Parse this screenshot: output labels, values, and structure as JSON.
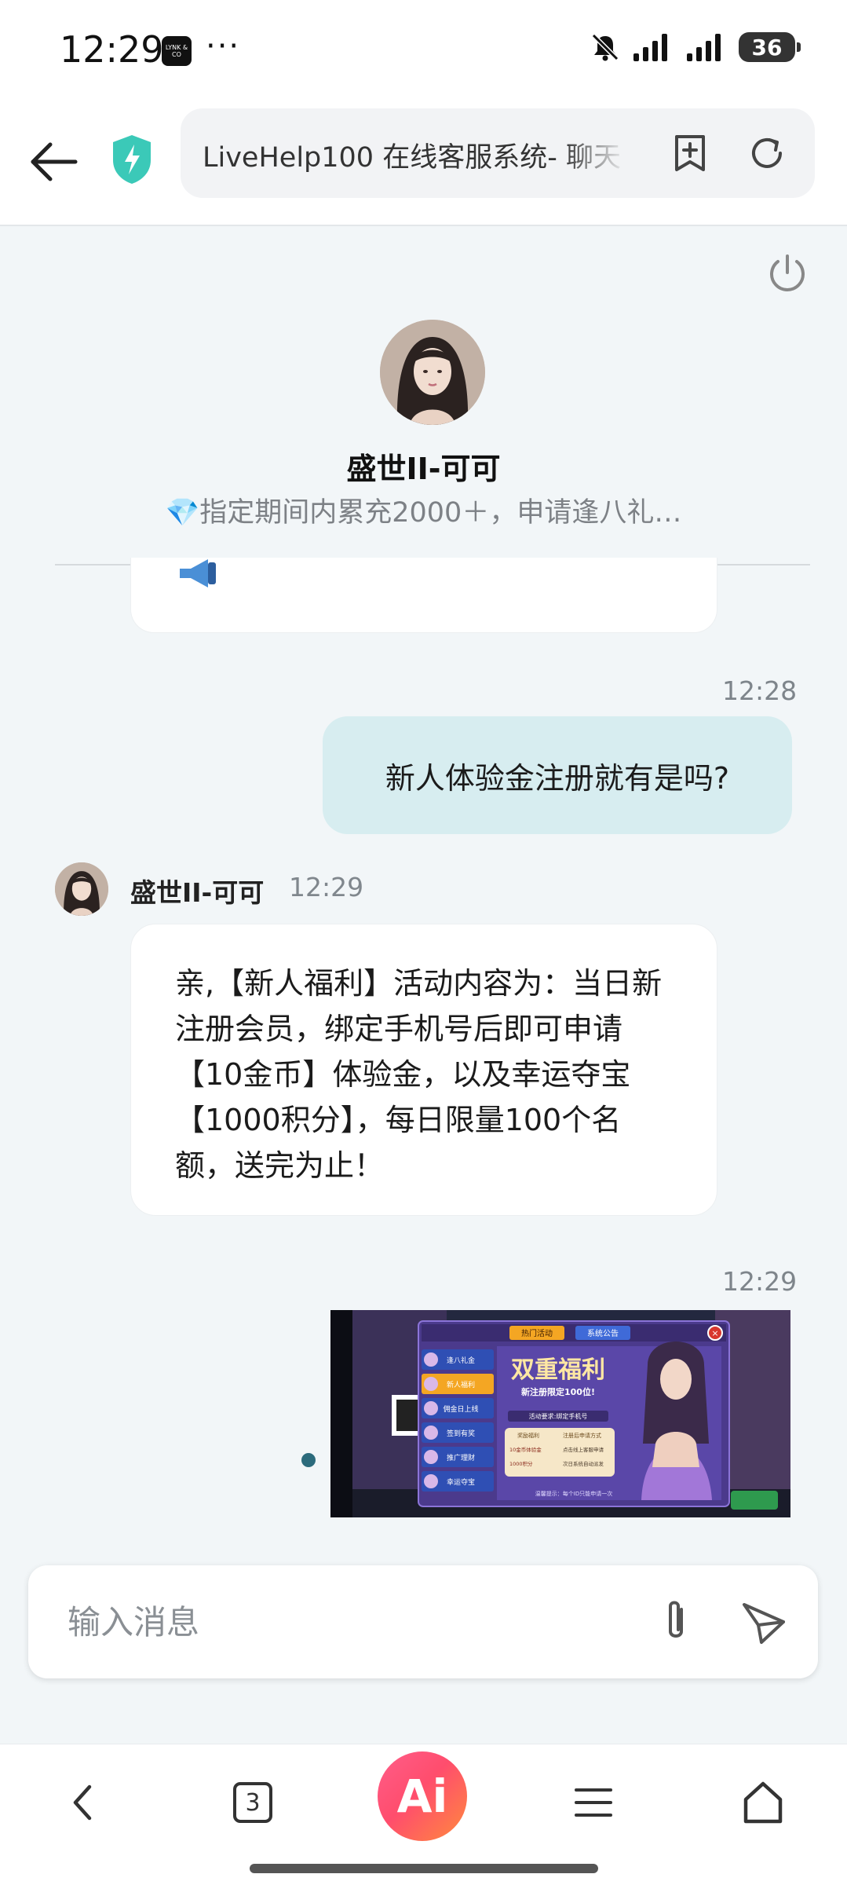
{
  "status_bar": {
    "time": "12:29",
    "app_icon_text": "LYNK & CO",
    "more": "···",
    "battery": "36"
  },
  "browser": {
    "url_title": "LiveHelp100 在线客服系统- 聊天"
  },
  "chat": {
    "agent_name": "盛世II-可可",
    "agent_subtitle": "💎指定期间内累充2000＋，申请逢八礼…",
    "messages": {
      "user_time": "12:28",
      "user_text": "新人体验金注册就有是吗?",
      "agent_sender": "盛世II-可可",
      "agent_time": "12:29",
      "agent_text": "亲,【新人福利】活动内容为：当日新注册会员，绑定手机号后即可申请【10金币】体验金，以及幸运夺宝【1000积分】，每日限量100个名额，送完为止！",
      "image_time": "12:29"
    },
    "image": {
      "tab_hot": "热门活动",
      "tab_notice": "系统公告",
      "menu": [
        "逢八礼金",
        "新人福利",
        "佣金日上线",
        "签到有奖",
        "推广理财",
        "幸运夺宝"
      ],
      "banner_title": "双重福利",
      "banner_sub": "新注册限定100位!",
      "info_line": "活动要求:绑定手机号",
      "left_col_header": "奖励福利",
      "right_col_header": "注册后申请方式",
      "row1_left": "10金币体验金",
      "row1_right": "点击线上客服申请",
      "row2_left": "1000积分",
      "row2_right": "次日系统自动派发",
      "footer": "温馨提示：每个ID只能申请一次"
    }
  },
  "input": {
    "placeholder": "输入消息"
  },
  "nav": {
    "tab_count": "3",
    "ai_label": "Ai"
  }
}
